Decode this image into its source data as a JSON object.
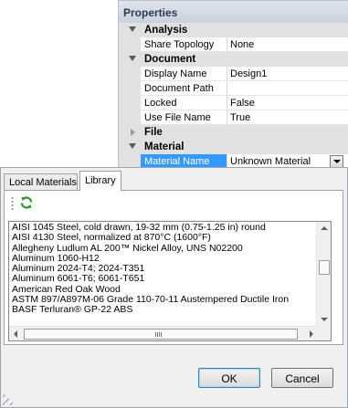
{
  "properties": {
    "title": "Properties",
    "rows": [
      {
        "type": "category",
        "label": "Analysis",
        "expanded": true
      },
      {
        "type": "property",
        "name": "Share Topology",
        "value": "None"
      },
      {
        "type": "category",
        "label": "Document",
        "expanded": true
      },
      {
        "type": "property",
        "name": "Display Name",
        "value": "Design1"
      },
      {
        "type": "property",
        "name": "Document Path",
        "value": ""
      },
      {
        "type": "property",
        "name": "Locked",
        "value": "False"
      },
      {
        "type": "property",
        "name": "Use File Name",
        "value": "True"
      },
      {
        "type": "category",
        "label": "File",
        "expanded": false
      },
      {
        "type": "category",
        "label": "Material",
        "expanded": true
      },
      {
        "type": "property",
        "name": "Material Name",
        "value": "Unknown Material",
        "selected": true,
        "dropdown": true
      }
    ]
  },
  "dialog": {
    "tabs": [
      {
        "label": "Local Materials",
        "active": false
      },
      {
        "label": "Library",
        "active": true
      }
    ],
    "toolbar": {
      "refresh_icon": "refresh-icon"
    },
    "materials": [
      "AISI 1045 Steel, cold drawn, 19-32 mm (0.75-1.25 in) round",
      "AISI 4130 Steel, normalized at 870°C (1600°F)",
      "Allegheny Ludlum AL 200™ Nickel Alloy, UNS N02200",
      "Aluminum 1060-H12",
      "Aluminum 2024-T4; 2024-T351",
      "Aluminum 6061-T6; 6061-T651",
      "American Red Oak Wood",
      "ASTM 897/A897M-06 Grade 110-70-11 Austempered Ductile Iron",
      "BASF Terluran® GP-22 ABS"
    ],
    "ok_label": "OK",
    "cancel_label": "Cancel"
  }
}
